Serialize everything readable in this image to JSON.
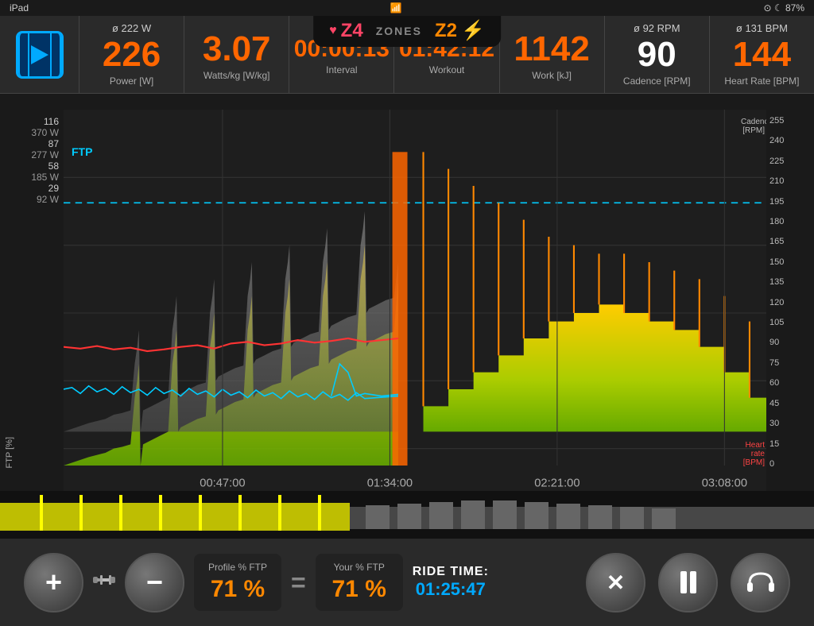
{
  "statusBar": {
    "device": "iPad",
    "wifi": "wifi",
    "battery": "87%",
    "batteryIcon": "🔋"
  },
  "zoneBar": {
    "z4Label": "Z4",
    "zonesLabel": "ZONES",
    "z2Label": "Z2"
  },
  "stats": [
    {
      "avg": "ø 222 W",
      "value": "226",
      "label": "Power [W]",
      "color": "orange"
    },
    {
      "avg": "",
      "value": "3.07",
      "label": "Watts/kg [W/kg]",
      "color": "orange"
    },
    {
      "avg": "",
      "value": "00:00:13",
      "label": "Interval",
      "color": "orange"
    },
    {
      "avg": "",
      "value": "01:42:12",
      "label": "Workout",
      "color": "orange"
    },
    {
      "avg": "",
      "value": "1142",
      "label": "Work [kJ]",
      "color": "orange"
    },
    {
      "avg": "ø 92 RPM",
      "value": "90",
      "label": "Cadence [RPM]",
      "color": "white"
    },
    {
      "avg": "ø 131 BPM",
      "value": "144",
      "label": "Heart Rate [BPM]",
      "color": "orange"
    }
  ],
  "chart": {
    "yLeftLabels": [
      {
        "pct": "116",
        "watts": "370 W"
      },
      {
        "pct": "87",
        "watts": "277 W"
      },
      {
        "pct": "58",
        "watts": "185 W"
      },
      {
        "pct": "29",
        "watts": "92 W"
      }
    ],
    "yRightLabels": [
      "255",
      "240",
      "225",
      "210",
      "195",
      "180",
      "165",
      "150",
      "135",
      "120",
      "105",
      "90",
      "75",
      "60",
      "45",
      "30",
      "15",
      "0"
    ],
    "xLabels": [
      "00:47:00",
      "01:34:00",
      "02:21:00",
      "03:08:00"
    ],
    "ftpLineLabel": "FTP",
    "cadenceLabel": "Cadence [RPM]",
    "hrLabel": "Heart rate [BPM]"
  },
  "controls": {
    "plusLabel": "+",
    "minusLabel": "−",
    "profileFtpLabel": "Profile % FTP",
    "profileFtpValue": "71 %",
    "yourFtpLabel": "Your % FTP",
    "yourFtpValue": "71 %",
    "rideTimeLabel": "RIDE TIME:",
    "rideTimeValue": "01:25:47"
  }
}
